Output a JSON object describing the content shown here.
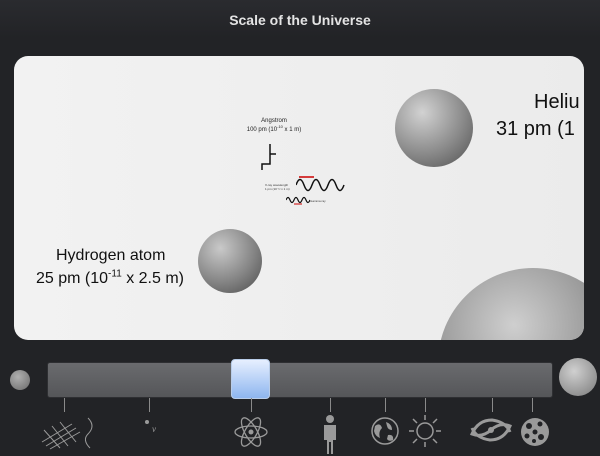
{
  "window": {
    "title": "Scale of the Universe"
  },
  "stage": {
    "hydrogen": {
      "name": "Hydrogen atom",
      "size_prefix": "25 pm (10",
      "size_exp": "-11",
      "size_suffix": " x 2.5 m)"
    },
    "helium": {
      "name": "Heliu",
      "size_prefix": "31 pm (1"
    },
    "angstrom": {
      "name": "Angstrom",
      "size_prefix": "100 pm (10",
      "size_exp": "-10",
      "size_suffix": " x 1 m)"
    },
    "xray_label": "X-ray wavelength\n1 pm (10⁻¹² x 1 m)",
    "gamma_label": "Gamma ray"
  },
  "slider": {
    "position_fraction": 0.41
  },
  "scale_icons": [
    "strings-grid-icon",
    "particle-icon",
    "atom-icon",
    "human-icon",
    "planet-icon",
    "sun-icon",
    "galaxy-icon",
    "universe-icon"
  ],
  "colors": {
    "thumb": "#a9c8f3",
    "background": "#222326",
    "stage": "#eeeeee"
  }
}
